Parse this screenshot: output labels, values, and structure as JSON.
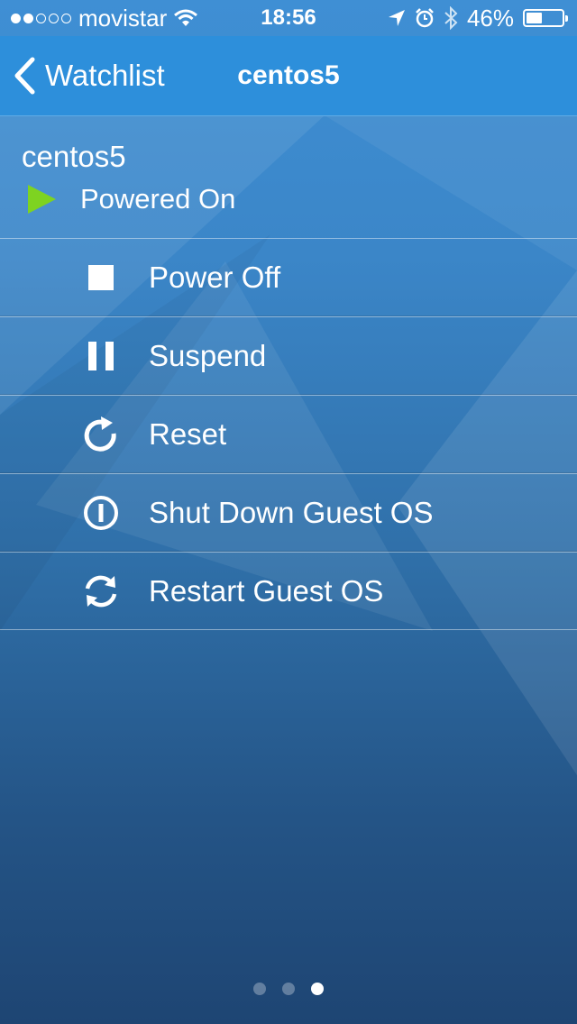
{
  "status_bar": {
    "carrier": "movistar",
    "signal_strength": 2,
    "signal_max": 5,
    "time": "18:56",
    "battery_percent": "46%",
    "battery_level": 0.46,
    "icons": [
      "wifi-icon",
      "location-arrow-icon",
      "alarm-icon",
      "bluetooth-icon",
      "battery-icon"
    ]
  },
  "nav": {
    "back_label": "Watchlist",
    "title": "centos5"
  },
  "vm": {
    "name": "centos5",
    "state": "Powered On",
    "state_color": "#7ed321"
  },
  "actions": [
    {
      "label": "Power Off",
      "icon": "stop-icon"
    },
    {
      "label": "Suspend",
      "icon": "pause-icon"
    },
    {
      "label": "Reset",
      "icon": "reset-icon"
    },
    {
      "label": "Shut Down Guest OS",
      "icon": "shutdown-icon"
    },
    {
      "label": "Restart Guest OS",
      "icon": "restart-icon"
    }
  ],
  "pager": {
    "count": 3,
    "active_index": 2
  },
  "colors": {
    "nav_bar": "#2d8fdb",
    "background_top": "#3f8fd4",
    "background_bottom": "#1e4573",
    "accent_green": "#7ed321"
  }
}
